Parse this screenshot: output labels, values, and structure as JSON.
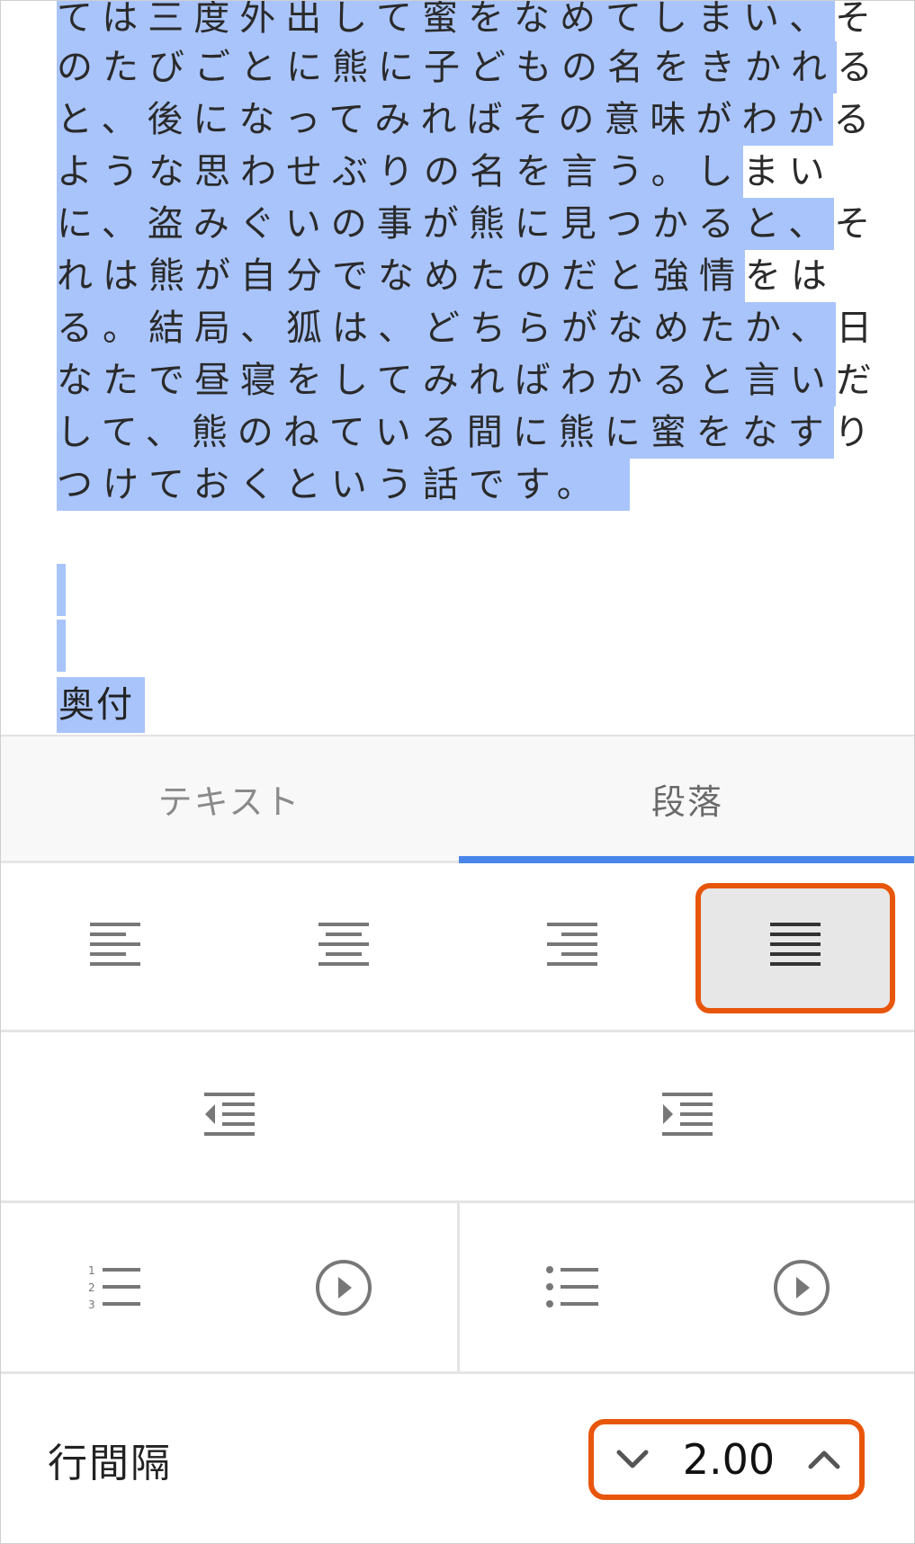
{
  "document": {
    "lines": [
      {
        "selected": "ては三度外出して蜜をなめてしまい、",
        "rest": "そ"
      },
      {
        "selected": "のたびごとに熊に子どもの名をきかれ",
        "rest": "る"
      },
      {
        "selected": "と、後になってみればその意味がわか",
        "rest": "る"
      },
      {
        "selected": "ような思わせぶりの名を言う。し",
        "rest": "まい"
      },
      {
        "selected": "に、盗みぐいの事が熊に見つかると、",
        "rest": "そ"
      },
      {
        "selected": "れは熊が自分でなめたのだと強情",
        "rest": "をは"
      },
      {
        "selected": "る。結局、狐は、どちらがなめたか、",
        "rest": "日"
      },
      {
        "selected": "なたで昼寝をしてみればわかると言い",
        "rest": "だ"
      },
      {
        "selected": "して、熊のねている間に熊に蜜をなす",
        "rest": "り"
      },
      {
        "selected": "つけておくという話です。",
        "rest": ""
      }
    ],
    "heading": "奥付"
  },
  "panel": {
    "tabs": [
      {
        "label": "テキスト",
        "active": false
      },
      {
        "label": "段落",
        "active": true
      }
    ],
    "alignment_selected": "justify",
    "line_spacing": {
      "label": "行間隔",
      "value": "2.00"
    }
  },
  "colors": {
    "selection": "#a9c4fb",
    "accent_tab": "#4a86ea",
    "highlight_outline": "#e8560b"
  },
  "icons": [
    "align-left-icon",
    "align-center-icon",
    "align-right-icon",
    "align-justify-icon",
    "outdent-icon",
    "indent-icon",
    "numbered-list-icon",
    "bulleted-list-icon",
    "chevron-right-circle-icon",
    "chevron-down-icon",
    "chevron-up-icon"
  ]
}
